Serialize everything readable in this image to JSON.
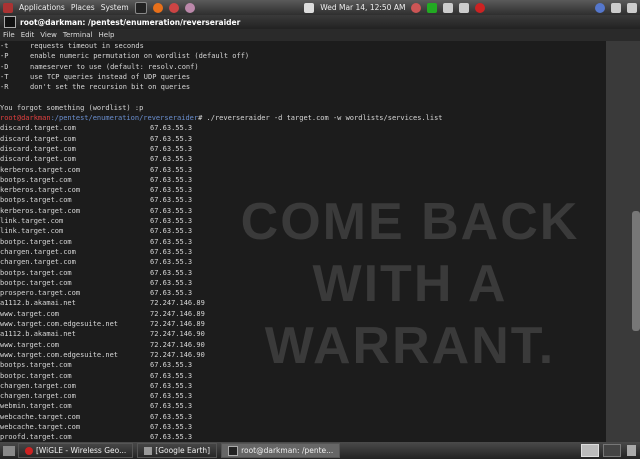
{
  "topbar": {
    "menus": [
      "Applications",
      "Places",
      "System"
    ],
    "clock": "Wed Mar 14, 12:50 AM"
  },
  "window": {
    "title": "root@darkman: /pentest/enumeration/reverseraider",
    "menu": [
      "File",
      "Edit",
      "View",
      "Terminal",
      "Help"
    ]
  },
  "terminal": {
    "help_lines": [
      {
        "flag": "-t",
        "desc": "requests timeout in seconds"
      },
      {
        "flag": "-P",
        "desc": "enable numeric permutation on wordlist (default off)"
      },
      {
        "flag": "-D",
        "desc": "nameserver to use (default: resolv.conf)"
      },
      {
        "flag": "-T",
        "desc": "use TCP queries instead of UDP queries"
      },
      {
        "flag": "-R",
        "desc": "don't set the recursion bit on queries"
      }
    ],
    "error": "You forgot something (wordlist) :p",
    "prompt_user": "root@darkman",
    "prompt_path": ":/pentest/enumeration/reverseraider",
    "command": "# ./reverseraider -d target.com -w wordlists/services.list",
    "results": [
      {
        "host": "discard.target.com",
        "ip": "67.63.55.3"
      },
      {
        "host": "discard.target.com",
        "ip": "67.63.55.3"
      },
      {
        "host": "discard.target.com",
        "ip": "67.63.55.3"
      },
      {
        "host": "discard.target.com",
        "ip": "67.63.55.3"
      },
      {
        "host": "kerberos.target.com",
        "ip": "67.63.55.3"
      },
      {
        "host": "bootps.target.com",
        "ip": "67.63.55.3"
      },
      {
        "host": "kerberos.target.com",
        "ip": "67.63.55.3"
      },
      {
        "host": "bootps.target.com",
        "ip": "67.63.55.3"
      },
      {
        "host": "kerberos.target.com",
        "ip": "67.63.55.3"
      },
      {
        "host": "link.target.com",
        "ip": "67.63.55.3"
      },
      {
        "host": "link.target.com",
        "ip": "67.63.55.3"
      },
      {
        "host": "bootpc.target.com",
        "ip": "67.63.55.3"
      },
      {
        "host": "chargen.target.com",
        "ip": "67.63.55.3"
      },
      {
        "host": "chargen.target.com",
        "ip": "67.63.55.3"
      },
      {
        "host": "bootps.target.com",
        "ip": "67.63.55.3"
      },
      {
        "host": "bootpc.target.com",
        "ip": "67.63.55.3"
      },
      {
        "host": "prospero.target.com",
        "ip": "67.63.55.3"
      },
      {
        "host": "a1112.b.akamai.net",
        "ip": "72.247.146.89"
      },
      {
        "host": "www.target.com",
        "ip": "72.247.146.89"
      },
      {
        "host": "www.target.com.edgesuite.net",
        "ip": "72.247.146.89"
      },
      {
        "host": "a1112.b.akamai.net",
        "ip": "72.247.146.90"
      },
      {
        "host": "www.target.com",
        "ip": "72.247.146.90"
      },
      {
        "host": "www.target.com.edgesuite.net",
        "ip": "72.247.146.90"
      },
      {
        "host": "bootps.target.com",
        "ip": "67.63.55.3"
      },
      {
        "host": "bootpc.target.com",
        "ip": "67.63.55.3"
      },
      {
        "host": "chargen.target.com",
        "ip": "67.63.55.3"
      },
      {
        "host": "chargen.target.com",
        "ip": "67.63.55.3"
      },
      {
        "host": "webmin.target.com",
        "ip": "67.63.55.3"
      },
      {
        "host": "webcache.target.com",
        "ip": "67.63.55.3"
      },
      {
        "host": "webcache.target.com",
        "ip": "67.63.55.3"
      },
      {
        "host": "proofd.target.com",
        "ip": "67.63.55.3"
      }
    ],
    "wallpaper_lines": [
      "COME BACK",
      "WITH A",
      "WARRANT."
    ]
  },
  "taskbar": {
    "tasks": [
      "[WiGLE - Wireless Geo...",
      "[Google Earth]",
      "root@darkman: /pente..."
    ]
  }
}
